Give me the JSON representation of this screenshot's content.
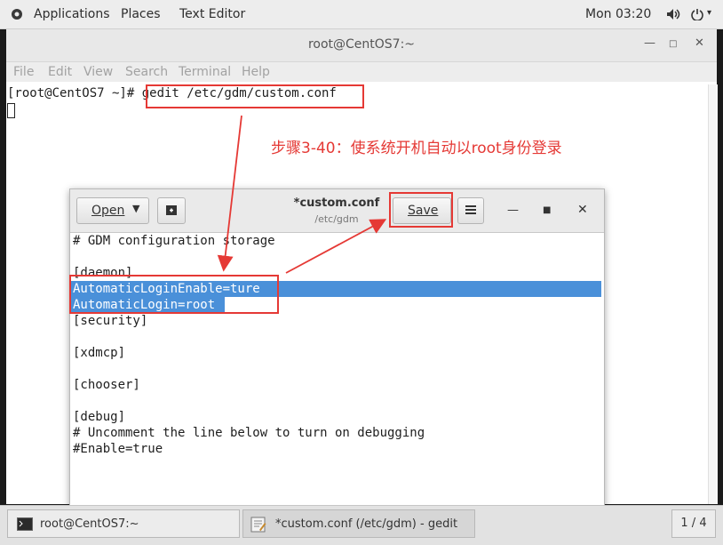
{
  "topbar": {
    "applications": "Applications",
    "places": "Places",
    "text_editor": "Text Editor",
    "clock": "Mon 03:20",
    "volume_icon": "volume-icon",
    "power_icon": "power-icon"
  },
  "terminal": {
    "title": "root@CentOS7:~",
    "menu": [
      "File",
      "Edit",
      "View",
      "Search",
      "Terminal",
      "Help"
    ],
    "prompt": "[root@CentOS7 ~]# ",
    "command": "gedit /etc/gdm/custom.conf"
  },
  "annotation": {
    "text": "步骤3-40：使系统开机自动以root身份登录"
  },
  "gedit": {
    "open_label": "Open",
    "title": "*custom.conf",
    "subtitle": "/etc/gdm",
    "save_label": "Save",
    "lines": [
      "# GDM configuration storage",
      "",
      "[daemon]",
      "AutomaticLoginEnable=ture",
      "AutomaticLogin=root",
      "[security]",
      "",
      "[xdmcp]",
      "",
      "[chooser]",
      "",
      "[debug]",
      "# Uncomment the line below to turn on debugging",
      "#Enable=true"
    ]
  },
  "taskbar": {
    "task1": "root@CentOS7:~",
    "task2": "*custom.conf (/etc/gdm) - gedit",
    "workspace": "1 / 4"
  }
}
